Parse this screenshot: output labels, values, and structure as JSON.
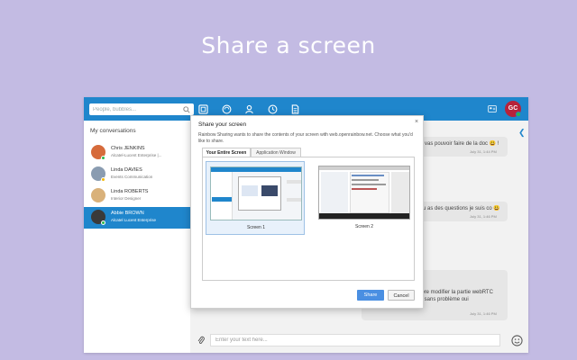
{
  "hero": {
    "title": "Share a screen"
  },
  "app": {
    "search": {
      "placeholder": "People, bubbles..."
    },
    "user": {
      "initials": "GC"
    },
    "sidebar": {
      "title": "My conversations",
      "conversations": [
        {
          "name": "Chris JENKINS",
          "subtitle": "Alcatel-Lucent Enterprise |...",
          "status_color": "#2db84d",
          "avatar_color": "#d66b3b"
        },
        {
          "name": "Linda DAVIES",
          "subtitle": "Events Communication",
          "status_color": "#f2b705",
          "avatar_color": "#8a9cb1"
        },
        {
          "name": "Linda ROBERTS",
          "subtitle": "Interior Designer",
          "status_color": "",
          "avatar_color": "#d9b17a"
        },
        {
          "name": "Abbie BROWN",
          "subtitle": "Alcatel Lucent Enterprise",
          "status_color": "#2db84d",
          "avatar_color": "#3a3a3a",
          "active": true
        }
      ]
    },
    "chat": {
      "messages": [
        {
          "text": "vas pouvoir faire de la doc 😃 !",
          "time": "July 31, 1:44 PM"
        },
        {
          "text": "u as des questions je suis co 😃",
          "time": "July 31, 1:46 PM"
        },
        {
          "lines": [
            "ncore modifier la partie webRTC",
            "fox sans problème oui"
          ],
          "time": "July 31, 1:46 PM"
        }
      ]
    },
    "composer": {
      "placeholder": "Enter your text here..."
    }
  },
  "dialog": {
    "title": "Share your screen",
    "description": "Rainbow Sharing wants to share the contents of your screen with web.openrainbow.net. Choose what you'd like to share.",
    "tabs": [
      "Your Entire Screen",
      "Application Window"
    ],
    "screens": [
      "Screen 1",
      "Screen 2"
    ],
    "share_label": "Share",
    "cancel_label": "Cancel"
  },
  "colors": {
    "background": "#c3bbe3",
    "brand": "#1f86cc",
    "share_button": "#4a8fe2"
  }
}
